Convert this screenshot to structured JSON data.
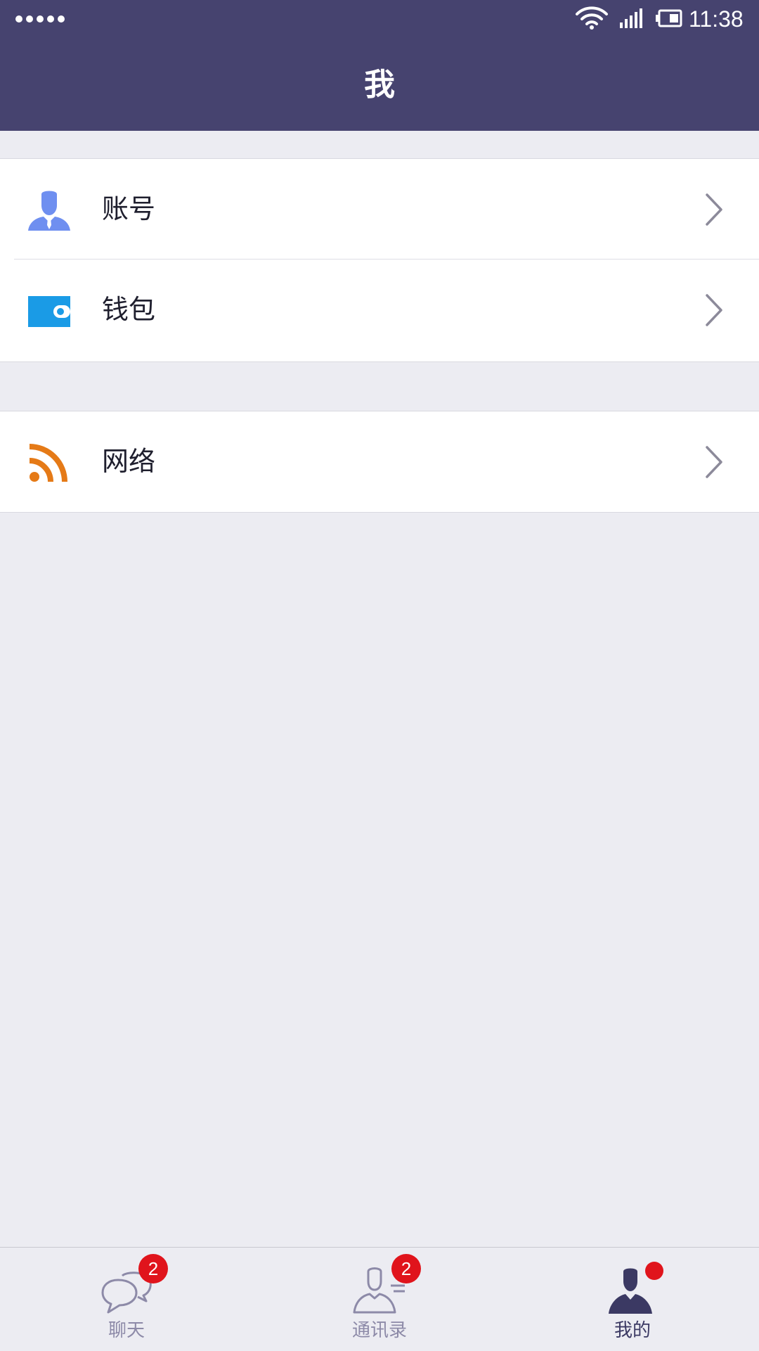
{
  "status_bar": {
    "time": "11:38",
    "icons": [
      "signal-dots-icon",
      "wifi-icon",
      "cellular-signal-icon",
      "battery-icon"
    ]
  },
  "header": {
    "title": "我"
  },
  "menu": {
    "groups": [
      {
        "items": [
          {
            "label": "账号",
            "icon": "account-person-icon",
            "icon_color": "#6f8ff0"
          },
          {
            "label": "钱包",
            "icon": "wallet-icon",
            "icon_color": "#1a9be6"
          }
        ]
      },
      {
        "items": [
          {
            "label": "网络",
            "icon": "network-rss-icon",
            "icon_color": "#e57a17"
          }
        ]
      }
    ]
  },
  "tabbar": {
    "tabs": [
      {
        "label": "聊天",
        "icon": "chat-bubbles-icon",
        "badge": "2",
        "active": false
      },
      {
        "label": "通讯录",
        "icon": "contacts-icon",
        "badge": "2",
        "active": false
      },
      {
        "label": "我的",
        "icon": "me-person-icon",
        "badge_dot": true,
        "active": true
      }
    ]
  },
  "colors": {
    "header_bg": "#46436f",
    "page_bg": "#ececf2",
    "badge": "#e0141c",
    "tab_inactive": "#8d8aa8",
    "tab_active": "#3b3963"
  }
}
